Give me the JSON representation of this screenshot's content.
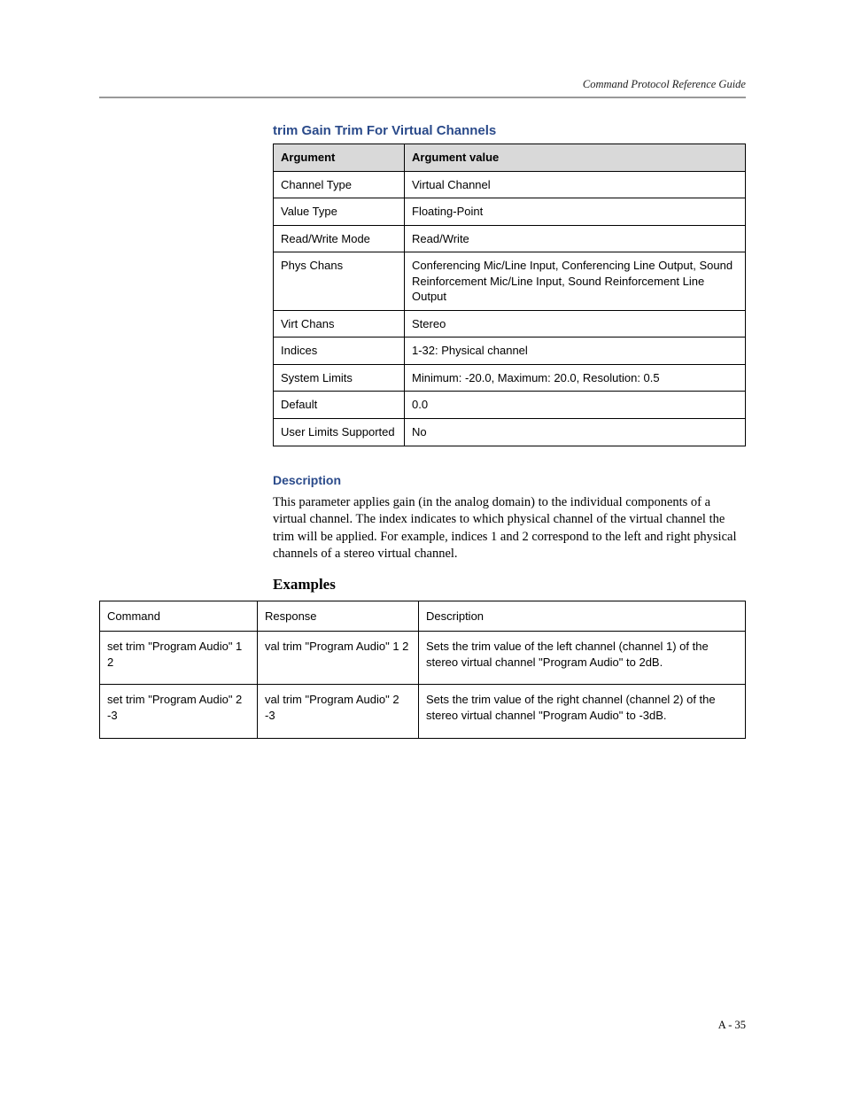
{
  "header": {
    "doc_title": "Command Protocol Reference Guide"
  },
  "section": {
    "title": "trim Gain Trim For Virtual Channels",
    "arg_headers": {
      "c1": "Argument",
      "c2": "Argument value"
    },
    "args": [
      {
        "name": "Channel Type",
        "value": "Virtual Channel"
      },
      {
        "name": "Value Type",
        "value": "Floating-Point"
      },
      {
        "name": "Read/Write Mode",
        "value": "Read/Write"
      },
      {
        "name": "Phys Chans",
        "value": "Conferencing Mic/Line Input, Conferencing Line Output, Sound Reinforcement Mic/Line Input, Sound Reinforcement Line Output"
      },
      {
        "name": "Virt Chans",
        "value": "Stereo"
      },
      {
        "name": "Indices",
        "value": "1-32: Physical channel"
      },
      {
        "name": "System Limits",
        "value": "Minimum: -20.0, Maximum: 20.0, Resolution: 0.5"
      },
      {
        "name": "Default",
        "value": "0.0"
      },
      {
        "name": "User Limits Supported",
        "value": "No"
      }
    ],
    "description_title": "Description",
    "description_body": "This parameter applies gain (in the analog domain) to the individual components of a virtual channel. The index indicates to which physical channel of the virtual channel the trim will be applied. For example, indices 1 and 2 correspond to the left and right physical channels of a stereo virtual channel.",
    "examples_title": "Examples",
    "ex_headers": {
      "c1": "Command",
      "c2": "Response",
      "c3": "Description"
    },
    "examples": [
      {
        "command": "set trim \"Program Audio\" 1 2",
        "response": "val trim \"Program Audio\" 1 2",
        "description": "Sets the trim value of the left channel (channel 1) of the stereo virtual channel \"Program Audio\" to 2dB."
      },
      {
        "command": "set trim \"Program Audio\" 2 -3",
        "response": "val trim \"Program Audio\" 2 -3",
        "description": "Sets the trim value of the right channel (channel 2) of the stereo virtual channel \"Program Audio\" to -3dB."
      }
    ]
  },
  "footer": {
    "page_number": "A - 35"
  }
}
